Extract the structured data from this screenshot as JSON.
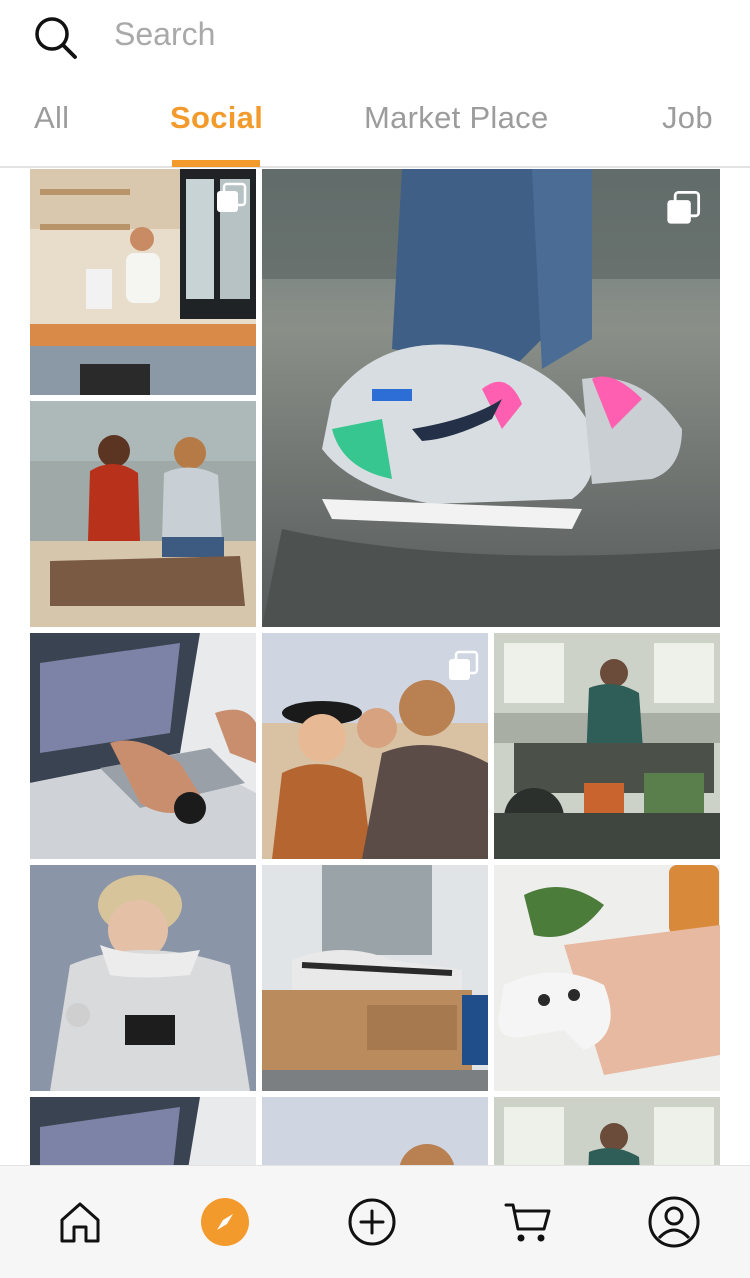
{
  "search": {
    "placeholder": "Search"
  },
  "tabs": [
    {
      "label": "All",
      "active": false
    },
    {
      "label": "Social",
      "active": true
    },
    {
      "label": "Market Place",
      "active": false
    },
    {
      "label": "Job",
      "active": false
    }
  ],
  "colors": {
    "accent": "#f39a2c",
    "tab_inactive": "#9c9c9c",
    "nav_bg": "#f6f6f6"
  },
  "feed": [
    {
      "subject": "barista at coffee counter",
      "multi": true
    },
    {
      "subject": "sneakers on pavement",
      "multi": true
    },
    {
      "subject": "two women sitting on beach log",
      "multi": false
    },
    {
      "subject": "hands typing on laptop",
      "multi": false
    },
    {
      "subject": "friends laughing",
      "multi": true
    },
    {
      "subject": "worker at workshop",
      "multi": false
    },
    {
      "subject": "woman in white hoodie",
      "multi": false
    },
    {
      "subject": "sneakers on boost box",
      "multi": false
    },
    {
      "subject": "game controller and keyboard",
      "multi": false
    },
    {
      "subject": "hands typing on laptop",
      "multi": false
    },
    {
      "subject": "friends laughing",
      "multi": false
    },
    {
      "subject": "worker at workshop",
      "multi": false
    }
  ],
  "bottom_nav": [
    {
      "icon": "home-icon",
      "active": false
    },
    {
      "icon": "compass-icon",
      "active": true
    },
    {
      "icon": "plus-circle-icon",
      "active": false
    },
    {
      "icon": "cart-icon",
      "active": false
    },
    {
      "icon": "profile-icon",
      "active": false
    }
  ]
}
